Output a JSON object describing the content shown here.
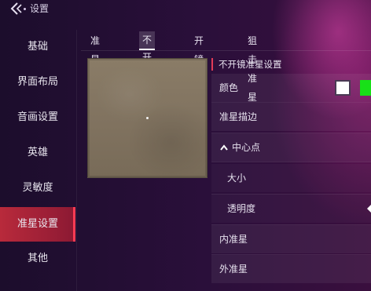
{
  "header": {
    "title": "设置"
  },
  "sidebar": {
    "items": [
      {
        "label": "基础"
      },
      {
        "label": "界面布局"
      },
      {
        "label": "音画设置"
      },
      {
        "label": "英雄"
      },
      {
        "label": "灵敏度"
      },
      {
        "label": "准星设置"
      },
      {
        "label": "其他"
      }
    ],
    "active_index": 5
  },
  "tabs": [
    {
      "label": "准星通用"
    },
    {
      "label": "不开镜准星"
    },
    {
      "label": "开镜准星"
    },
    {
      "label": "狙击准星"
    }
  ],
  "active_tab_index": 1,
  "settings": {
    "section_title": "不开镜准星设置",
    "rows": {
      "color": {
        "label": "颜色"
      },
      "outline": {
        "label": "准星描边"
      },
      "center_dot": {
        "label": "中心点"
      },
      "size": {
        "label": "大小"
      },
      "opacity": {
        "label": "透明度"
      },
      "inner": {
        "label": "内准星"
      },
      "outer": {
        "label": "外准星"
      }
    },
    "color_swatches": [
      "#ffffff",
      "#18e018"
    ]
  },
  "colors": {
    "accent": "#e23b57",
    "active_sidebar": "#b82a3b"
  }
}
